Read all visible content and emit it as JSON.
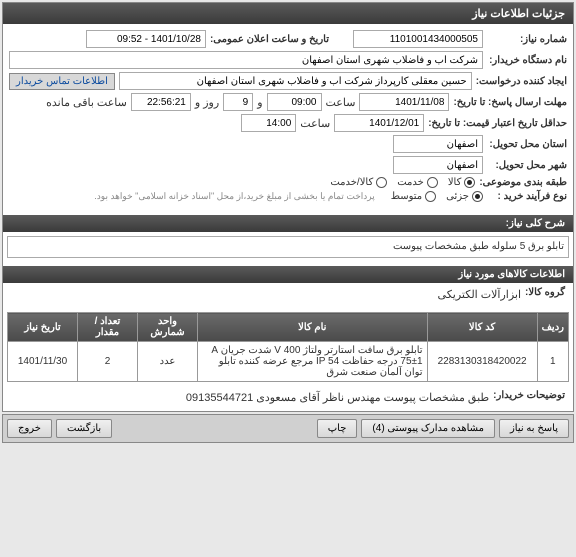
{
  "header": {
    "title": "جزئیات اطلاعات نیاز"
  },
  "fields": {
    "need_number_label": "شماره نیاز:",
    "need_number": "1101001434000505",
    "announce_label": "تاریخ و ساعت اعلان عمومی:",
    "announce": "1401/10/28 - 09:52",
    "buyer_label": "نام دستگاه خریدار:",
    "buyer": "شرکت آب و فاضلاب شهری استان اصفهان",
    "requester_label": "ایجاد کننده درخواست:",
    "requester": "حسین معقلی کارپرداز شرکت آب و فاضلاب شهری استان اصفهان",
    "contact_btn": "اطلاعات تماس خریدار",
    "deadline_label": "مهلت ارسال پاسخ: تا تاریخ:",
    "deadline_date": "1401/11/08",
    "hour_label": "ساعت",
    "deadline_hour": "09:00",
    "day_and": "و",
    "days_remaining": "9",
    "days_remaining_lbl": "روز و",
    "time_remaining": "22:56:21",
    "time_remaining_lbl": "ساعت باقی مانده",
    "validity_label": "حداقل تاریخ اعتبار قیمت: تا تاریخ:",
    "validity_date": "1401/12/01",
    "validity_hour": "14:00",
    "city_exec_label": "استان محل تحویل:",
    "city_exec": "اصفهان",
    "city_deliv_label": "شهر محل تحویل:",
    "city_deliv": "اصفهان",
    "topic_label": "طبقه بندی موضوعی:",
    "topic_goods": "کالا",
    "topic_service": "خدمت",
    "topic_goodservice": "کالا/خدمت",
    "process_label": "نوع فرآیند خرید :",
    "process_partial": "جزئی",
    "process_medium": "متوسط",
    "process_note": "پرداخت تمام یا بخشی از مبلغ خرید،از محل \"اسناد خزانه اسلامی\" خواهد بود."
  },
  "sections": {
    "need_desc_title": "شرح کلی نیاز:",
    "need_desc": "تابلو برق 5 سلوله طبق مشخصات پیوست",
    "goods_info_title": "اطلاعات کالاهای مورد نیاز",
    "goods_group_label": "گروه کالا:",
    "goods_group_value": "ابزارآلات الکتریکی",
    "buyer_notes_label": "توضیحات خریدار:",
    "buyer_notes": "طبق مشخصات پیوست مهندس ناظر آقای مسعودی 09135544721"
  },
  "table": {
    "headers": {
      "idx": "ردیف",
      "code": "کد کالا",
      "name": "نام کالا",
      "unit": "واحد شمارش",
      "qty": "تعداد / مقدار",
      "date": "تاریخ نیاز"
    },
    "rows": [
      {
        "idx": "1",
        "code": "2283130318420022",
        "name": "تابلو برق سافت استارتر ولتاژ V 400 شدت جریان A 75±1 درجه حفاظت IP 54 مرجع عرضه کننده تابلو توان آلمان صنعت شرق",
        "unit": "عدد",
        "qty": "2",
        "date": "1401/11/30"
      }
    ]
  },
  "footer": {
    "reply": "پاسخ به نیاز",
    "attachments": "مشاهده مدارک پیوستی (4)",
    "print": "چاپ",
    "back": "بازگشت",
    "exit": "خروج"
  }
}
